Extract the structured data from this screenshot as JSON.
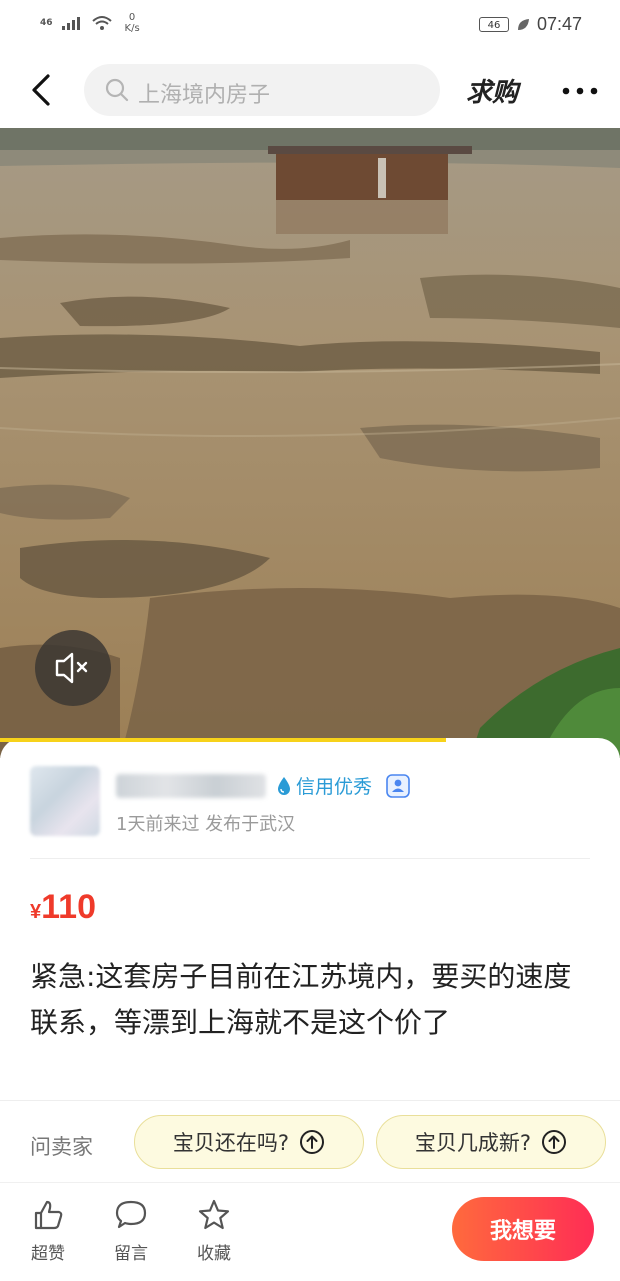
{
  "status_bar": {
    "network": "46",
    "speed_value": "0",
    "speed_unit": "K/s",
    "battery": "46",
    "time": "07:47"
  },
  "nav": {
    "search_placeholder": "上海境内房子",
    "qiugou_label": "求购"
  },
  "seller": {
    "credit_label": "信用优秀",
    "meta": "1天前来过 发布于武汉"
  },
  "listing": {
    "currency": "¥",
    "price": "110",
    "description": "紧急:这套房子目前在江苏境内，要买的速度联系，等漂到上海就不是这个价了"
  },
  "quick_questions": {
    "ask_seller": "问卖家",
    "q1": "宝贝还在吗?",
    "q2": "宝贝几成新?"
  },
  "bottom_bar": {
    "like_label": "超赞",
    "comment_label": "留言",
    "favorite_label": "收藏",
    "want_label": "我想要"
  },
  "colors": {
    "price": "#ef3a2a",
    "credit": "#2a9bd6",
    "want_button": "#ff2d55",
    "progress": "#f7d21a"
  },
  "video": {
    "progress_fraction": 0.72
  }
}
